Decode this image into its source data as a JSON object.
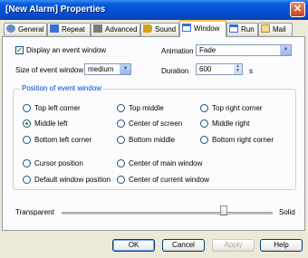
{
  "window": {
    "title": "[New Alarm] Properties",
    "close_glyph": "✕"
  },
  "tabs": [
    {
      "label": "General",
      "icon": "gear-icon",
      "color": "#6A8AC0"
    },
    {
      "label": "Repeat",
      "icon": "repeat-icon",
      "color": "#3A6FD8"
    },
    {
      "label": "Advanced",
      "icon": "advanced-icon",
      "color": "#7A7A7A"
    },
    {
      "label": "Sound",
      "icon": "sound-icon",
      "color": "#D4A017"
    },
    {
      "label": "Window",
      "icon": "window-icon",
      "color": "#2E6FE0"
    },
    {
      "label": "Run",
      "icon": "run-icon",
      "color": "#2E6FE0"
    },
    {
      "label": "Mail",
      "icon": "mail-icon",
      "color": "#D9B44A"
    }
  ],
  "window_tab": {
    "display_event_window": {
      "label": "Display an event window",
      "checked": true
    },
    "size_label": "Size of event window",
    "size_value": "medium",
    "animation_label": "Animation",
    "animation_value": "Fade",
    "duration_label": "Duration",
    "duration_value": "600",
    "duration_unit": "s",
    "position_group_label": "Position of event window",
    "positions": [
      {
        "label": "Top left corner",
        "selected": false
      },
      {
        "label": "Top middle",
        "selected": false
      },
      {
        "label": "Top right corner",
        "selected": false
      },
      {
        "label": "Middle left",
        "selected": true
      },
      {
        "label": "Center of screen",
        "selected": false
      },
      {
        "label": "Middle right",
        "selected": false
      },
      {
        "label": "Bottom left corner",
        "selected": false
      },
      {
        "label": "Bottom middle",
        "selected": false
      },
      {
        "label": "Bottom right corner",
        "selected": false
      },
      {
        "label": "Cursor position",
        "selected": false
      },
      {
        "label": "Center of main window",
        "selected": false
      },
      {
        "label": "Default window position",
        "selected": false
      },
      {
        "label": "Center of current window",
        "selected": false
      }
    ],
    "transparency": {
      "left_label": "Transparent",
      "right_label": "Solid",
      "value": 0.77
    }
  },
  "buttons": {
    "ok": "OK",
    "cancel": "Cancel",
    "apply": "Apply",
    "help": "Help"
  }
}
